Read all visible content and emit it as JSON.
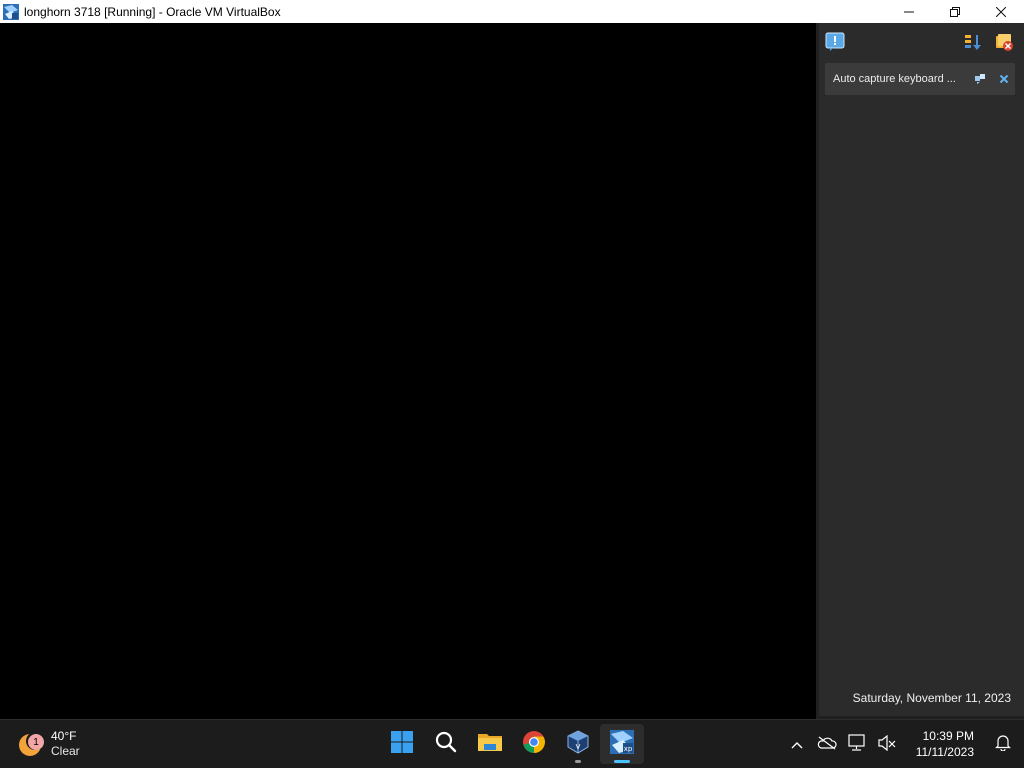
{
  "window": {
    "title": "longhorn 3718 [Running] - Oracle VM VirtualBox",
    "icon": "virtualbox-vm-icon",
    "controls": {
      "minimize": "—",
      "restore": "❐",
      "close": "✕"
    }
  },
  "side_panel": {
    "toolbar_icons": [
      "notification-center-icon",
      "sort-icon",
      "clear-all-icon"
    ],
    "notification": {
      "text": "Auto capture keyboard ...",
      "actions": [
        "toggle-icon",
        "close-icon"
      ]
    },
    "date": "Saturday, November 11, 2023"
  },
  "taskbar": {
    "weather": {
      "badge": "1",
      "temp": "40°F",
      "condition": "Clear"
    },
    "apps": [
      {
        "name": "start",
        "icon": "windows-start-icon"
      },
      {
        "name": "search",
        "icon": "search-icon"
      },
      {
        "name": "file-explorer",
        "icon": "folder-icon"
      },
      {
        "name": "chrome",
        "icon": "chrome-icon"
      },
      {
        "name": "virtualbox",
        "icon": "virtualbox-icon"
      },
      {
        "name": "vm-window",
        "icon": "virtualbox-vm-icon"
      }
    ],
    "tray": {
      "icons": [
        "chevron-up-icon",
        "onedrive-icon",
        "network-icon",
        "volume-muted-icon"
      ],
      "time": "10:39 PM",
      "date": "11/11/2023",
      "notification_icon": "bell-icon"
    }
  },
  "colors": {
    "accent": "#4cc2ff",
    "panel_bg": "#2b2b2b",
    "taskbar_bg": "#1c1c1c"
  }
}
